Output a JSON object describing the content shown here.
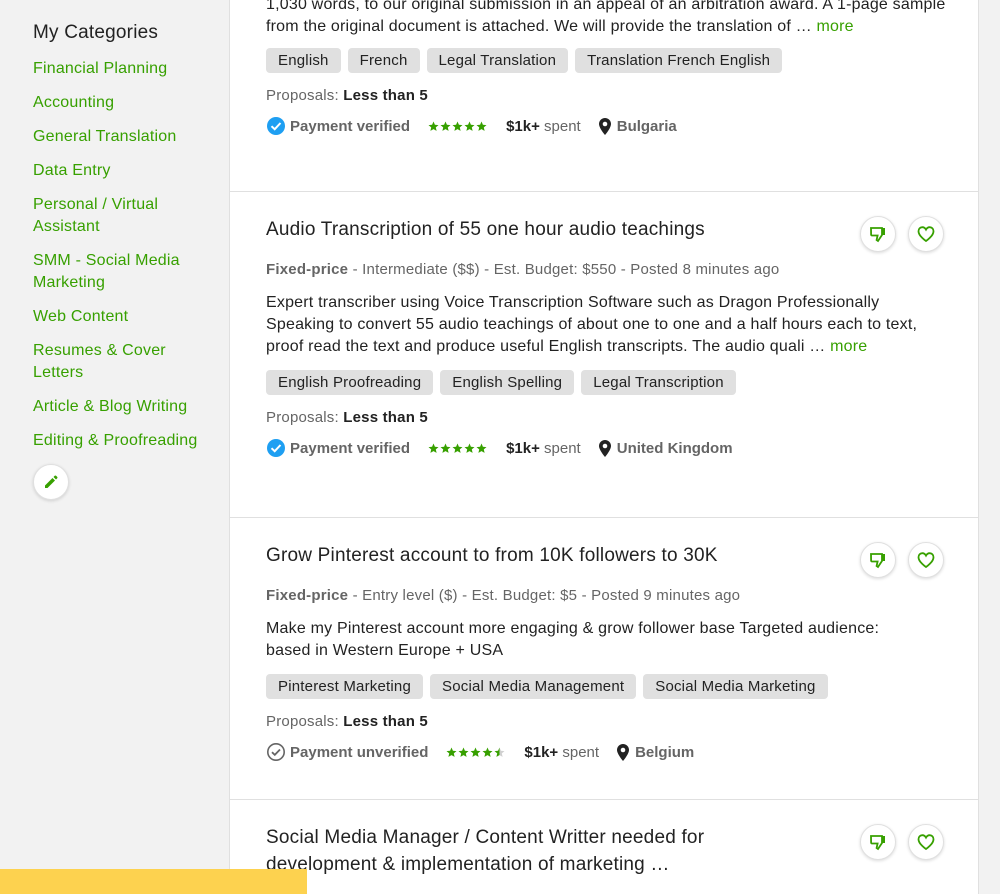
{
  "sidebar": {
    "heading": "My Categories",
    "items": [
      {
        "label": "Financial Planning"
      },
      {
        "label": "Accounting"
      },
      {
        "label": "General Translation"
      },
      {
        "label": "Data Entry"
      },
      {
        "label": "Personal / Virtual Assistant"
      },
      {
        "label": "SMM - Social Media Marketing"
      },
      {
        "label": "Web Content"
      },
      {
        "label": "Resumes & Cover Letters"
      },
      {
        "label": "Article & Blog Writing"
      },
      {
        "label": "Editing & Proofreading"
      }
    ],
    "edit_icon": "pencil-icon"
  },
  "colors": {
    "accent": "#37a000",
    "verified": "#1e9ff2",
    "tag_bg": "#e0e0e0",
    "banner": "#fdd24f"
  },
  "jobs": [
    {
      "desc": "1,030 words, to our original submission in an appeal of an arbitration award. A 1-page sample from the original document is attached. We will provide the translation of …",
      "more": "more",
      "tags": [
        "English",
        "French",
        "Legal Translation",
        "Translation French English"
      ],
      "proposals_label": "Proposals:",
      "proposals_value": "Less than 5",
      "payment": "Payment verified",
      "rating": 5,
      "spent_amount": "$1k+",
      "spent_label": "spent",
      "location": "Bulgaria"
    },
    {
      "title": "Audio Transcription of 55 one hour audio teachings",
      "type": "Fixed-price",
      "details": "- Intermediate ($$) - Est. Budget: $550 - Posted 8 minutes ago",
      "desc": "Expert transcriber using Voice Transcription Software such as Dragon Professionally Speaking to convert 55 audio teachings of about one to one and a half hours each to text, proof read the text and produce useful English transcripts. The audio quali …",
      "more": "more",
      "tags": [
        "English Proofreading",
        "English Spelling",
        "Legal Transcription"
      ],
      "proposals_label": "Proposals:",
      "proposals_value": "Less than 5",
      "payment": "Payment verified",
      "rating": 5,
      "spent_amount": "$1k+",
      "spent_label": "spent",
      "location": "United Kingdom"
    },
    {
      "title": "Grow Pinterest account to from 10K followers to 30K",
      "type": "Fixed-price",
      "details": "- Entry level ($) - Est. Budget: $5 - Posted 9 minutes ago",
      "desc": "Make my Pinterest account more engaging & grow follower base Targeted audience: based in Western Europe + USA",
      "tags": [
        "Pinterest Marketing",
        "Social Media Management",
        "Social Media Marketing"
      ],
      "proposals_label": "Proposals:",
      "proposals_value": "Less than 5",
      "payment": "Payment unverified",
      "rating": 4.5,
      "spent_amount": "$1k+",
      "spent_label": "spent",
      "location": "Belgium"
    },
    {
      "title": "Social Media Manager / Content Writter needed for development & implementation of marketing …"
    }
  ]
}
